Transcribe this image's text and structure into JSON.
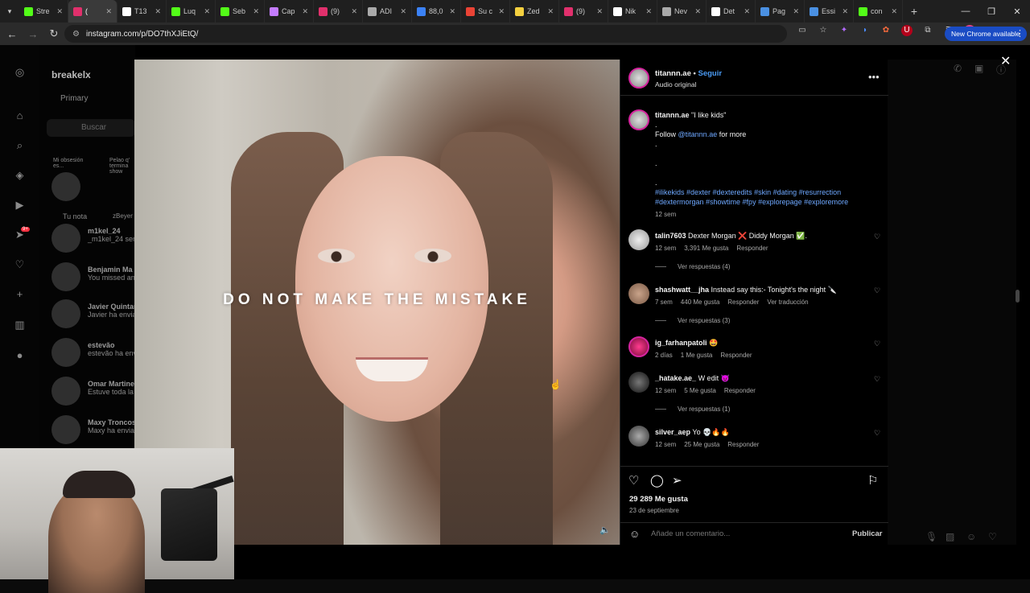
{
  "browser": {
    "tabs": [
      {
        "title": "Stre",
        "icon": "kick-icon",
        "color": "#53fc18"
      },
      {
        "title": "(",
        "icon": "instagram-icon",
        "color": "#e1306c",
        "active": true
      },
      {
        "title": "T13",
        "icon": "x-icon",
        "color": "#ffffff"
      },
      {
        "title": "Luq",
        "icon": "kick-icon",
        "color": "#53fc18"
      },
      {
        "title": "Seb",
        "icon": "kick-icon",
        "color": "#53fc18"
      },
      {
        "title": "Cap",
        "icon": "pen-icon",
        "color": "#c47cff"
      },
      {
        "title": "(9)",
        "icon": "instagram-icon",
        "color": "#e1306c"
      },
      {
        "title": "ADI",
        "icon": "mountain-icon",
        "color": "#aaaaaa"
      },
      {
        "title": "88,0",
        "icon": "x-blue-icon",
        "color": "#3b82f6"
      },
      {
        "title": "Su c",
        "icon": "gmail-icon",
        "color": "#ea4335"
      },
      {
        "title": "Zed",
        "icon": "pin-icon",
        "color": "#f4d03f"
      },
      {
        "title": "(9)",
        "icon": "instagram-icon",
        "color": "#e1306c"
      },
      {
        "title": "Nik",
        "icon": "nike-icon",
        "color": "#ffffff"
      },
      {
        "title": "Nev",
        "icon": "globe-icon",
        "color": "#aaaaaa"
      },
      {
        "title": "Det",
        "icon": "wikipedia-icon",
        "color": "#ffffff"
      },
      {
        "title": "Pag",
        "icon": "globe-blue-icon",
        "color": "#4a90e2"
      },
      {
        "title": "Essi",
        "icon": "arrows-icon",
        "color": "#4a90e2"
      },
      {
        "title": "con",
        "icon": "kick-icon",
        "color": "#53fc18"
      }
    ],
    "url": "instagram.com/p/DO7thXJiEtQ/",
    "new_chrome_label": "New Chrome available"
  },
  "background": {
    "dm_username": "breakelx",
    "dm_tab": "Primary",
    "dm_search_placeholder": "Buscar",
    "note_label": "Tu nota",
    "note2_label": "zBeyer",
    "note_bubble1": "Mi obsesión es...",
    "note_bubble2": "Pelao q' termina show",
    "conversations": [
      {
        "name": "m1kel_24",
        "sub": "_m1kel_24 sent a..."
      },
      {
        "name": "Benjamin Ma",
        "sub": "You missed an a..."
      },
      {
        "name": "Javier Quintan",
        "sub": "Javier ha enviad..."
      },
      {
        "name": "estevão",
        "sub": "estevão ha envia..."
      },
      {
        "name": "Omar Martine",
        "sub": "Estuve toda la ..."
      },
      {
        "name": "Maxy Troncos",
        "sub": "Maxy ha enviad..."
      }
    ],
    "notif_badge": "9+"
  },
  "post": {
    "overlay_text": "DO NOT MAKE THE MISTAKE",
    "author": "titannn.ae",
    "follow_label": "Seguir",
    "audio": "Audio original",
    "caption": {
      "username": "titannn.ae",
      "text": "\"I like kids\"",
      "follow_prefix": "Follow",
      "follow_handle": "@titannn.ae",
      "follow_suffix": "for more",
      "hashtags": "#ilikekids #dexter #dexteredits #skin #dating #resurrection #dextermorgan #showtime #fpy #explorepage #exploremore",
      "time": "12 sem"
    },
    "comments": [
      {
        "user": "talin7603",
        "text": "Dexter Morgan ❌ Diddy Morgan ✅.",
        "time": "12 sem",
        "likes": "3,391 Me gusta",
        "reply": "Responder",
        "extra": "",
        "replies": "Ver respuestas (4)"
      },
      {
        "user": "shashwatt__jha",
        "text": "Instead say this:- Tonight's the night 🔪",
        "time": "7 sem",
        "likes": "440 Me gusta",
        "reply": "Responder",
        "extra": "Ver traducción",
        "replies": "Ver respuestas (3)"
      },
      {
        "user": "ig_farhanpatoli",
        "text": "🤩",
        "time": "2 días",
        "likes": "1 Me gusta",
        "reply": "Responder",
        "extra": "",
        "replies": ""
      },
      {
        "user": "_hatake.ae_",
        "text": "W edit 😈",
        "time": "12 sem",
        "likes": "5 Me gusta",
        "reply": "Responder",
        "extra": "",
        "replies": "Ver respuestas (1)"
      },
      {
        "user": "silver_aep",
        "text": "Yo 💀🔥🔥",
        "time": "12 sem",
        "likes": "25 Me gusta",
        "reply": "Responder",
        "extra": "",
        "replies": ""
      }
    ],
    "likes_count": "29 289 Me gusta",
    "date": "23 de septiembre",
    "comment_placeholder": "Añade un comentario...",
    "publish_label": "Publicar"
  },
  "colors": {
    "accent_link": "#4a9bf5",
    "chrome_badge": "#1a4cc4",
    "bg": "#000000"
  }
}
